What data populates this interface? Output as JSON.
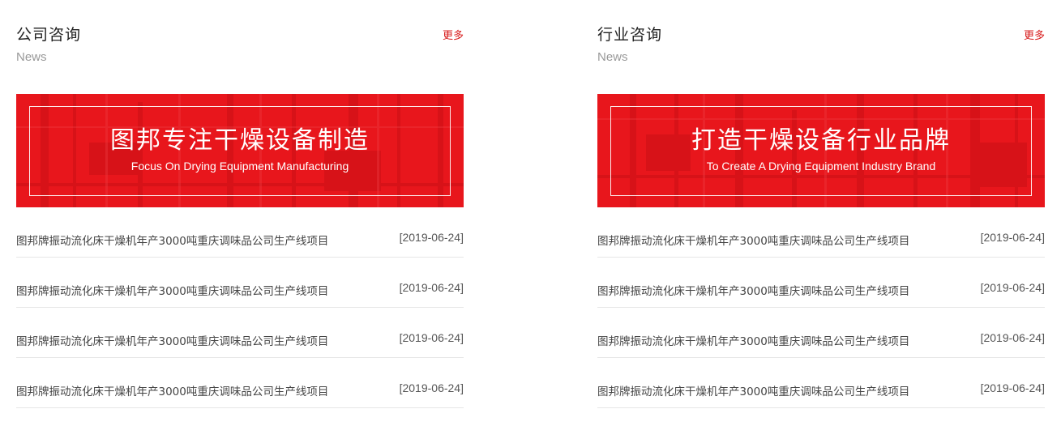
{
  "left": {
    "title": "公司咨询",
    "subtitle": "News",
    "more": "更多",
    "banner": {
      "headline": "图邦专注干燥设备制造",
      "tagline": "Focus On Drying Equipment Manufacturing"
    },
    "items": [
      {
        "title": "图邦牌振动流化床干燥机年产3000吨重庆调味品公司生产线项目",
        "date": "[2019-06-24]"
      },
      {
        "title": "图邦牌振动流化床干燥机年产3000吨重庆调味品公司生产线项目",
        "date": "[2019-06-24]"
      },
      {
        "title": "图邦牌振动流化床干燥机年产3000吨重庆调味品公司生产线项目",
        "date": "[2019-06-24]"
      },
      {
        "title": "图邦牌振动流化床干燥机年产3000吨重庆调味品公司生产线项目",
        "date": "[2019-06-24]"
      }
    ]
  },
  "right": {
    "title": "行业咨询",
    "subtitle": "News",
    "more": "更多",
    "banner": {
      "headline": "打造干燥设备行业品牌",
      "tagline": "To Create A Drying Equipment Industry Brand"
    },
    "items": [
      {
        "title": "图邦牌振动流化床干燥机年产3000吨重庆调味品公司生产线项目",
        "date": "[2019-06-24]"
      },
      {
        "title": "图邦牌振动流化床干燥机年产3000吨重庆调味品公司生产线项目",
        "date": "[2019-06-24]"
      },
      {
        "title": "图邦牌振动流化床干燥机年产3000吨重庆调味品公司生产线项目",
        "date": "[2019-06-24]"
      },
      {
        "title": "图邦牌振动流化床干燥机年产3000吨重庆调味品公司生产线项目",
        "date": "[2019-06-24]"
      }
    ]
  },
  "colors": {
    "accent": "#d71a1a",
    "banner_red": "#e8161c",
    "divider": "#e6e6e6",
    "muted": "#999999"
  }
}
